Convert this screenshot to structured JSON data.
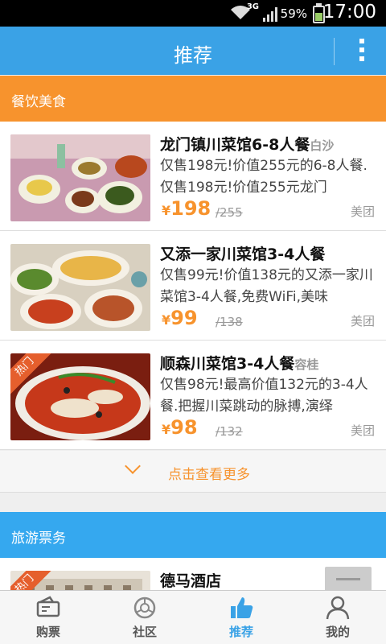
{
  "status_bar": {
    "network": "3G",
    "battery": "59%",
    "time": "17:00"
  },
  "app_bar": {
    "title": "推荐"
  },
  "sections": {
    "food": {
      "title": "餐饮美食"
    },
    "travel": {
      "title": "旅游票务"
    }
  },
  "food_deals": [
    {
      "name": "龙门镇川菜馆6-8人餐",
      "area": "白沙",
      "desc": "仅售198元!价值255元的6-8人餐.仅售198元!价值255元龙门",
      "currency": "¥",
      "price": "198",
      "original": "/255",
      "source": "美团",
      "hot": false
    },
    {
      "name": "又添一家川菜馆3-4人餐",
      "area": "",
      "desc": "仅售99元!价值138元的又添一家川菜馆3-4人餐,免费WiFi,美味",
      "currency": "¥",
      "price": "99",
      "original": "/138",
      "source": "美团",
      "hot": false
    },
    {
      "name": "顺森川菜馆3-4人餐",
      "area": "容桂",
      "desc": "仅售98元!最高价值132元的3-4人餐.把握川菜跳动的脉搏,演绎",
      "currency": "¥",
      "price": "98",
      "original": "/132",
      "source": "美团",
      "hot": true,
      "badge": "热门"
    }
  ],
  "more_link": {
    "label": "点击查看更多"
  },
  "travel_deals": [
    {
      "name": "德马酒店",
      "badge": "热门"
    }
  ],
  "tabs": [
    {
      "label": "购票",
      "icon": "ticket-icon",
      "active": false
    },
    {
      "label": "社区",
      "icon": "community-icon",
      "active": false
    },
    {
      "label": "推荐",
      "icon": "thumbs-up-icon",
      "active": true
    },
    {
      "label": "我的",
      "icon": "person-icon",
      "active": false
    }
  ],
  "colors": {
    "primary": "#3aa2e6",
    "accent": "#f7932d",
    "hot_badge": "#e55f2d"
  }
}
